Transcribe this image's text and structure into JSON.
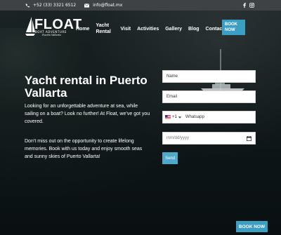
{
  "topbar": {
    "phone": "+52 (33) 3321 6512",
    "email": "info@float.mx",
    "social_icons": [
      "facebook-icon",
      "instagram-icon"
    ]
  },
  "logo": {
    "word": "FLOAT",
    "tagline": "BOAT ADVENTURE",
    "script": "Puerto Vallarta"
  },
  "nav": {
    "items": [
      {
        "label": "Home"
      },
      {
        "label": "Yacht Rental"
      },
      {
        "label": "Visit"
      },
      {
        "label": "Activities"
      },
      {
        "label": "Gallery"
      },
      {
        "label": "Blog"
      },
      {
        "label": "Contact"
      }
    ],
    "book_label": "BOOK NOW"
  },
  "hero": {
    "title": "Yacht rental in Puerto Vallarta",
    "paragraph1": "Looking for an unforgettable adventure at sea, while sailing on a boat? Look no further! At Float, we’ve got you covered.",
    "paragraph2": "Don’t miss out on the opportunity to create lifelong memories. Book with us today and enjoy smooth seas and sunny skies of Puerto Vallarta!"
  },
  "form": {
    "name_placeholder": "Name",
    "email_placeholder": "Email",
    "phone_code": "+1",
    "phone_placeholder": "Whatsapp",
    "date_placeholder": "mm/dd/yyyy",
    "send_label": "Send"
  },
  "floating_book_label": "BOOK NOW",
  "colors": {
    "accent": "#3a9fc3",
    "topbar": "#3f4244",
    "send": "#4ea9cb"
  }
}
